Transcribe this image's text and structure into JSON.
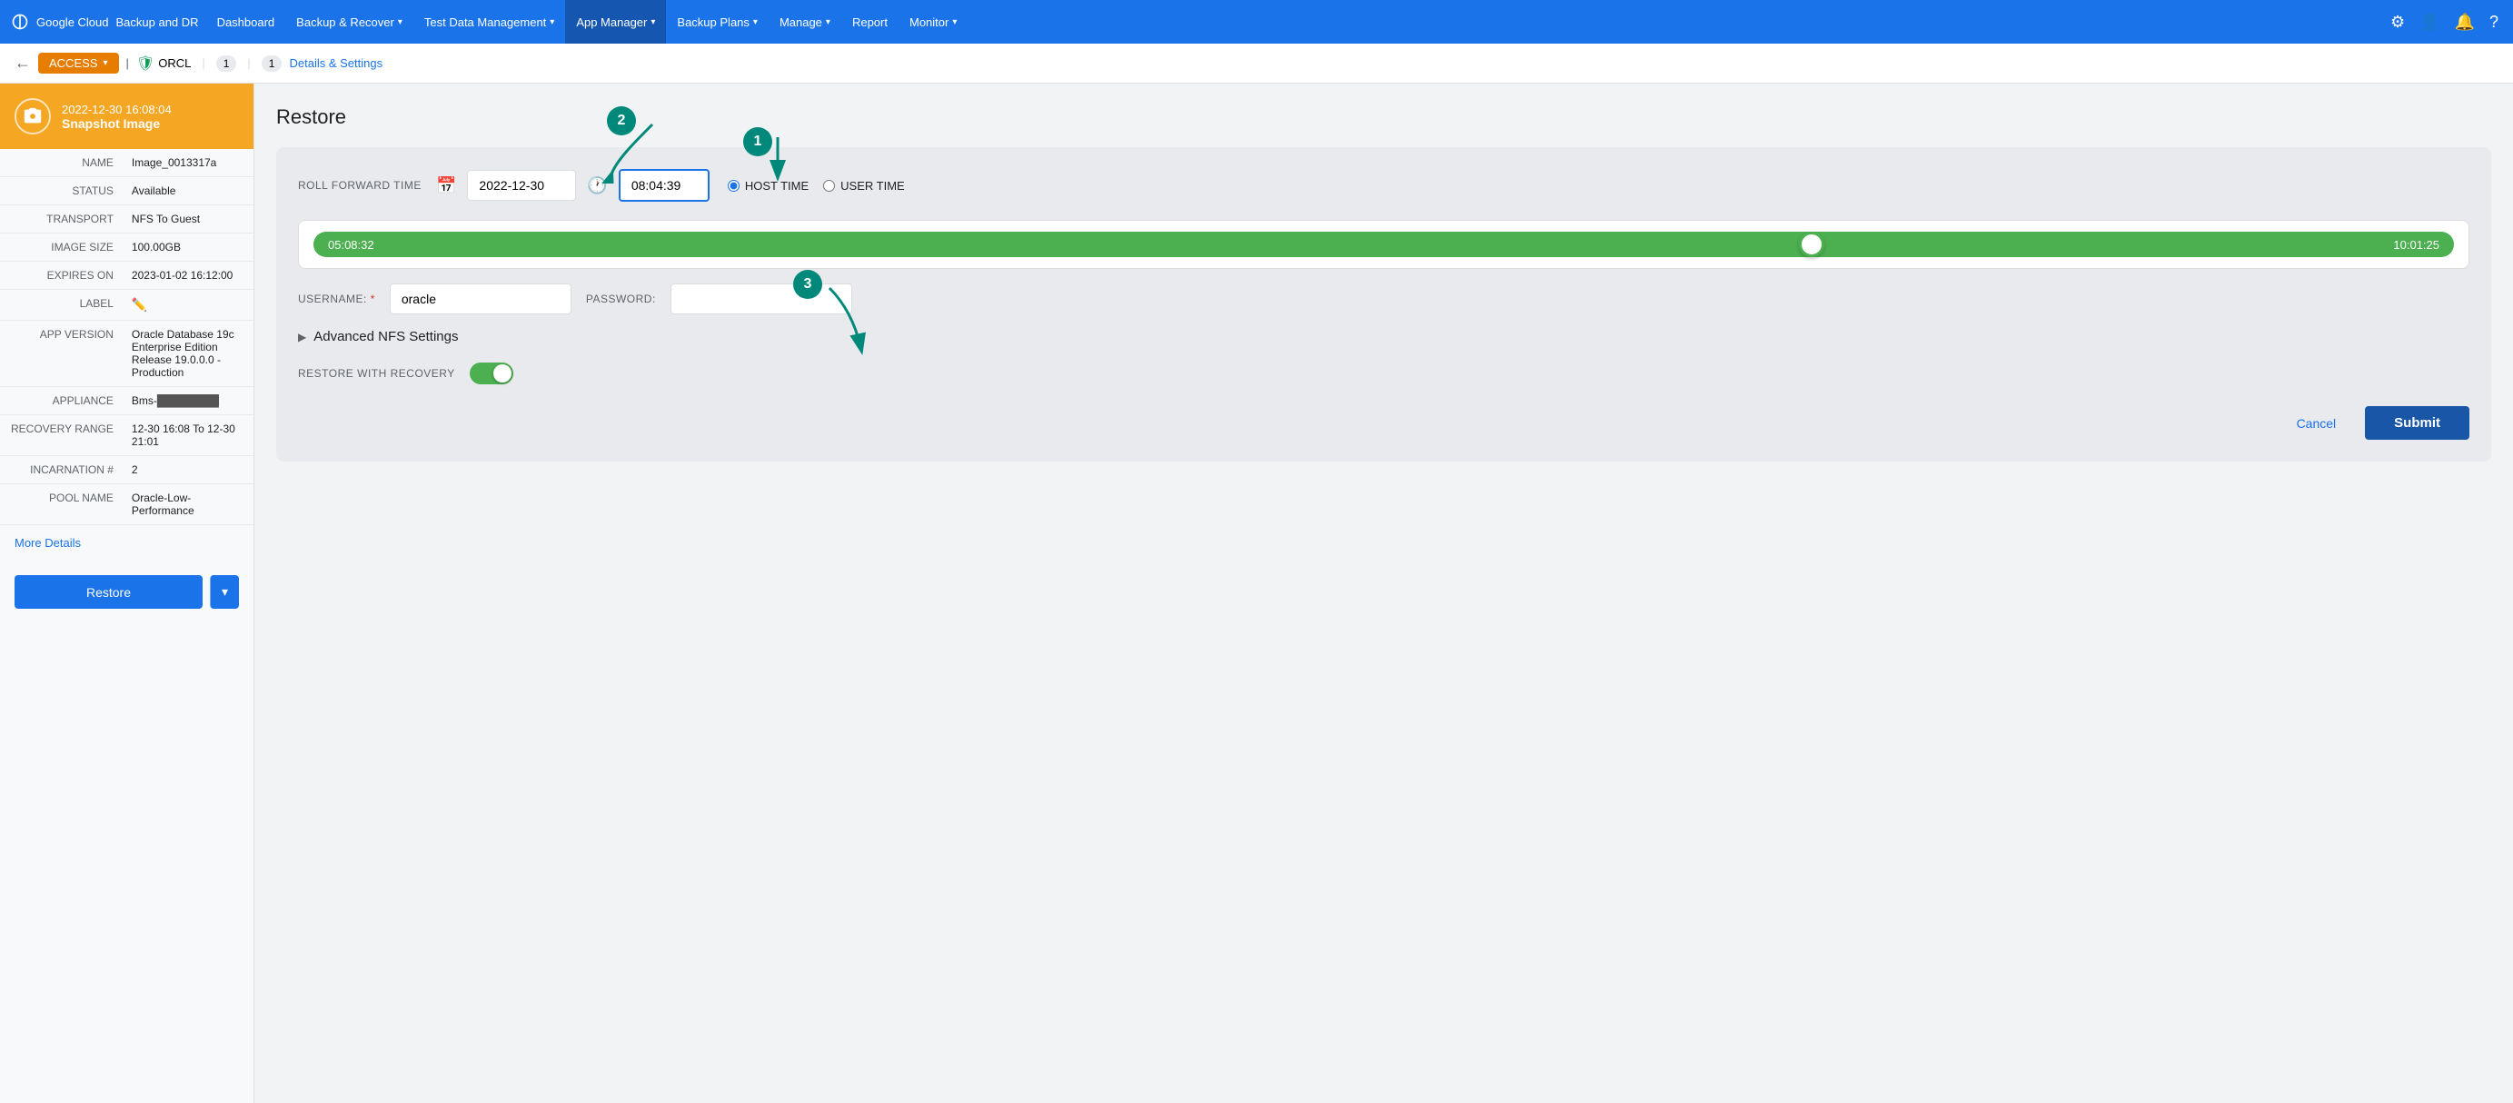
{
  "nav": {
    "brand_google": "Google Cloud",
    "brand_product": "Backup and DR",
    "items": [
      {
        "label": "Dashboard",
        "active": false
      },
      {
        "label": "Backup & Recover",
        "active": false,
        "hasDropdown": true
      },
      {
        "label": "Test Data Management",
        "active": false,
        "hasDropdown": true
      },
      {
        "label": "App Manager",
        "active": true,
        "hasDropdown": true
      },
      {
        "label": "Backup Plans",
        "active": false,
        "hasDropdown": true
      },
      {
        "label": "Manage",
        "active": false,
        "hasDropdown": true
      },
      {
        "label": "Report",
        "active": false
      },
      {
        "label": "Monitor",
        "active": false,
        "hasDropdown": true
      }
    ]
  },
  "breadcrumb": {
    "access_label": "ACCESS",
    "orcl_label": "ORCL",
    "badge1": "1",
    "badge2": "1",
    "details_link": "Details & Settings"
  },
  "left_panel": {
    "snapshot_date": "2022-12-30  16:08:04",
    "snapshot_label": "Snapshot Image",
    "fields": [
      {
        "key": "NAME",
        "value": "Image_0013317a"
      },
      {
        "key": "STATUS",
        "value": "Available"
      },
      {
        "key": "TRANSPORT",
        "value": "NFS To Guest"
      },
      {
        "key": "IMAGE SIZE",
        "value": "100.00GB"
      },
      {
        "key": "EXPIRES ON",
        "value": "2023-01-02 16:12:00"
      },
      {
        "key": "LABEL",
        "value": "✏"
      },
      {
        "key": "APP VERSION",
        "value": "Oracle Database 19c Enterprise Edition Release 19.0.0.0 - Production"
      },
      {
        "key": "APPLIANCE",
        "value": "Bms-████"
      },
      {
        "key": "RECOVERY RANGE",
        "value": "12-30 16:08 To 12-30 21:01"
      },
      {
        "key": "INCARNATION #",
        "value": "2"
      },
      {
        "key": "POOL NAME",
        "value": "Oracle-Low-Performance"
      }
    ],
    "more_details": "More Details",
    "restore_btn": "Restore"
  },
  "right_panel": {
    "title": "Restore",
    "roll_forward": {
      "label": "ROLL FORWARD TIME",
      "date_value": "2022-12-30",
      "time_value": "08:04:39",
      "host_time_label": "HOST TIME",
      "user_time_label": "USER TIME"
    },
    "timeline": {
      "left_time": "05:08:32",
      "right_time": "10:01:25"
    },
    "username": {
      "label": "USERNAME:",
      "value": "oracle",
      "placeholder": "oracle"
    },
    "password": {
      "label": "PASSWORD:",
      "value": "",
      "placeholder": ""
    },
    "advanced_nfs": "Advanced NFS Settings",
    "restore_recovery": {
      "label": "RESTORE WITH RECOVERY"
    },
    "cancel_btn": "Cancel",
    "submit_btn": "Submit",
    "annotations": {
      "1": "1",
      "2": "2",
      "3": "3"
    }
  }
}
